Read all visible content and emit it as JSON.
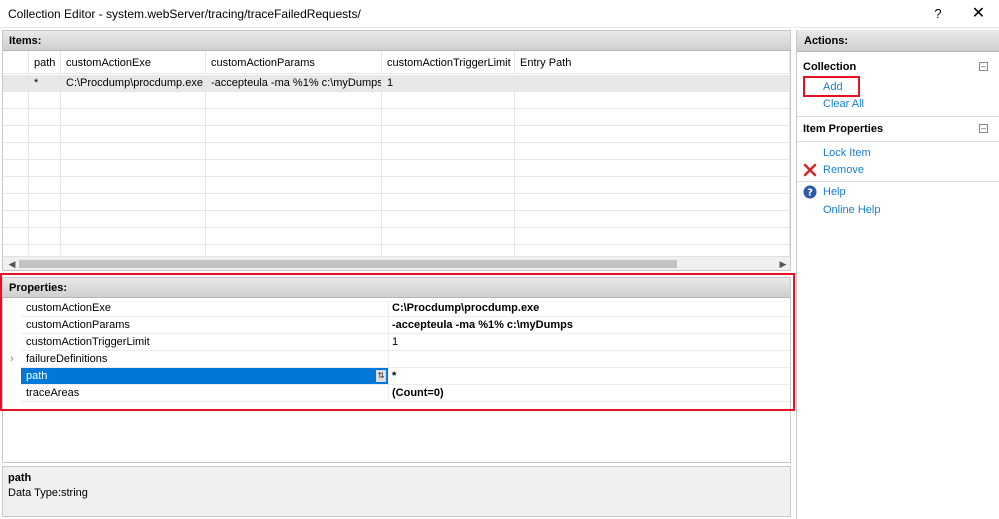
{
  "window": {
    "title": "Collection Editor - system.webServer/tracing/traceFailedRequests/",
    "help_label": "?",
    "close_label": "✕"
  },
  "items": {
    "header": "Items:",
    "columns": [
      "path",
      "customActionExe",
      "customActionParams",
      "customActionTriggerLimit",
      "Entry Path"
    ],
    "rows": [
      [
        "*",
        "C:\\Procdump\\procdump.exe",
        "-accepteula -ma %1% c:\\myDumps",
        "1",
        ""
      ]
    ]
  },
  "properties": {
    "header": "Properties:",
    "rows": [
      {
        "name": "customActionExe",
        "value": "C:\\Procdump\\procdump.exe",
        "bold": true,
        "expandable": false,
        "selected": false
      },
      {
        "name": "customActionParams",
        "value": "-accepteula -ma %1% c:\\myDumps",
        "bold": true,
        "expandable": false,
        "selected": false
      },
      {
        "name": "customActionTriggerLimit",
        "value": "1",
        "bold": false,
        "expandable": false,
        "selected": false
      },
      {
        "name": "failureDefinitions",
        "value": "",
        "bold": false,
        "expandable": true,
        "selected": false
      },
      {
        "name": "path",
        "value": "*",
        "bold": true,
        "expandable": false,
        "selected": true
      },
      {
        "name": "traceAreas",
        "value": "(Count=0)",
        "bold": true,
        "expandable": false,
        "selected": false
      }
    ]
  },
  "description": {
    "title": "path",
    "text": "Data Type:string"
  },
  "actions": {
    "header": "Actions:",
    "collection": {
      "label": "Collection",
      "add": "Add",
      "clear_all": "Clear All"
    },
    "item_properties": {
      "label": "Item Properties",
      "lock_item": "Lock Item",
      "remove": "Remove",
      "help": "Help",
      "online_help": "Online Help"
    }
  },
  "colors": {
    "link": "#1a7fc9",
    "selection": "#0078d7",
    "highlight": "#e81123"
  }
}
